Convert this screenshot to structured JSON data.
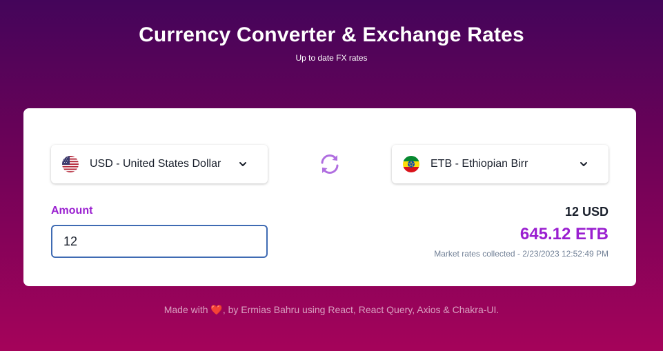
{
  "header": {
    "title": "Currency Converter & Exchange Rates",
    "subtitle": "Up to date FX rates"
  },
  "converter": {
    "from_currency": {
      "label": "USD - United States Dollar",
      "flag_icon": "us-flag-icon"
    },
    "to_currency": {
      "label": "ETB - Ethiopian Birr",
      "flag_icon": "ethiopia-flag-icon"
    },
    "swap_icon": "swap-arrows-icon",
    "amount_label": "Amount",
    "amount_value": "12",
    "result": {
      "from_amount": "12 USD",
      "to_amount": "645.12 ETB",
      "note": "Market rates collected - 2/23/2023 12:52:49 PM"
    }
  },
  "footer": {
    "prefix": "Made with ",
    "heart": "❤️",
    "suffix": ", by Ermias Bahru using React, React Query, Axios & Chakra-UI."
  },
  "colors": {
    "accent": "#9a1fd0",
    "input_border": "#3f6bb3",
    "background_top": "#44055a",
    "background_bottom": "#a5035a"
  }
}
